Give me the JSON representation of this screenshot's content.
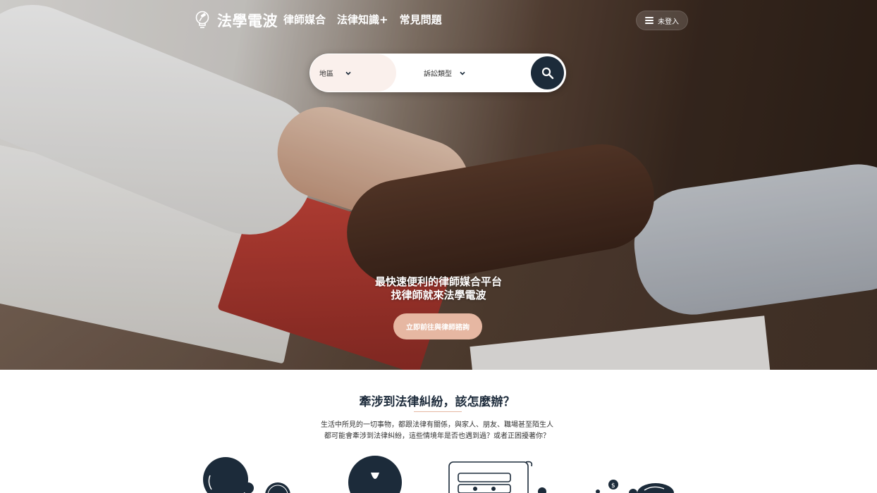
{
  "brand": {
    "name": "法學電波",
    "logo_icon": "lightbulb-gavel-icon"
  },
  "nav": {
    "links": [
      "律師媒合",
      "法律知識+",
      "常見問題"
    ],
    "login_label": "未登入",
    "menu_icon": "hamburger-menu-icon"
  },
  "search": {
    "region_label": "地區",
    "type_label": "訴訟類型",
    "button_icon": "search-icon"
  },
  "hero": {
    "title_line1": "最快速便利的律師媒合平台",
    "title_line2": "找律師就來法學電波",
    "cta_label": "立即前往與律師諮詢"
  },
  "section": {
    "title": "牽涉到法律糾紛，該怎麼辦？",
    "desc_line1": "生活中所見的一切事物，都跟法律有關係，與家人、朋友、職場甚至陌生人",
    "desc_line2": "都可能會牽涉到法律糾紛，這些情境年是否也遇到過？或者正困擾著你？"
  },
  "colors": {
    "navy": "#1c2b3a",
    "accent_peach": "#e6b7a2",
    "region_bg": "#faf0ec"
  }
}
